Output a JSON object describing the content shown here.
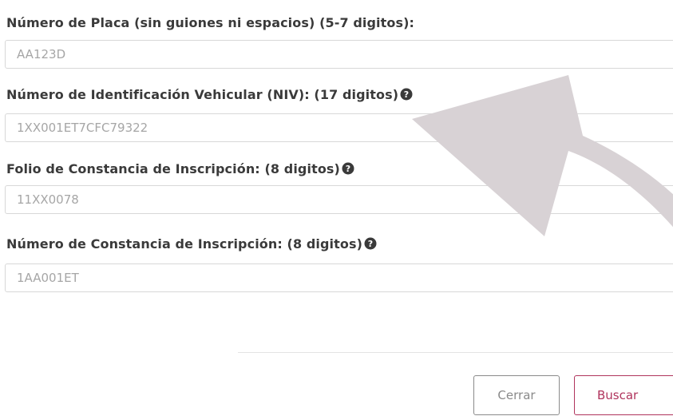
{
  "form": {
    "plate": {
      "label": "Número de Placa (sin guiones ni espacios) (5-7 digitos):",
      "placeholder": "AA123D"
    },
    "niv": {
      "label": "Número de Identificación Vehicular (NIV): (17 digitos)",
      "placeholder": "1XX001ET7CFC79322"
    },
    "folio": {
      "label": "Folio de Constancia de Inscripción: (8 digitos)",
      "placeholder": "11XX0078"
    },
    "constancia": {
      "label": "Número de Constancia de Inscripción: (8 digitos)",
      "placeholder": "1AA001ET"
    }
  },
  "buttons": {
    "close_label": "Cerrar",
    "search_label": "Buscar"
  },
  "icons": {
    "help": "question-circle-icon",
    "overlay": "curved-arrow-icon"
  },
  "colors": {
    "accent": "#b0345d",
    "overlay_arrow": "#d8d2d5"
  }
}
